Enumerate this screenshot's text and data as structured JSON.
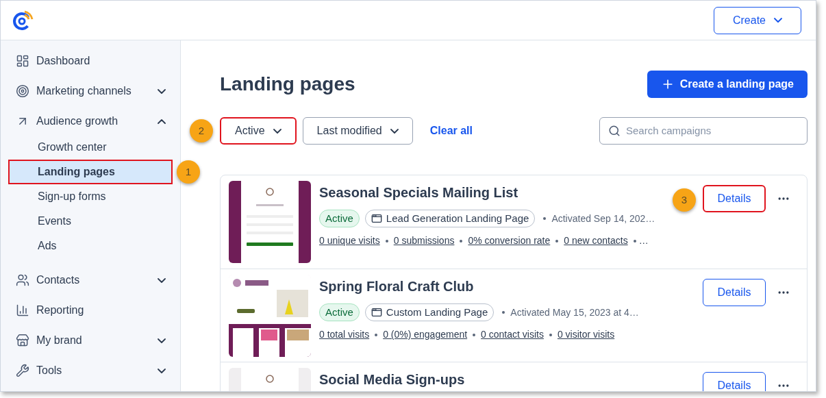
{
  "header": {
    "create_button": "Create"
  },
  "sidebar": {
    "items": [
      {
        "kind": "link",
        "label": "Dashboard"
      },
      {
        "kind": "group",
        "label": "Marketing channels",
        "expanded": false
      },
      {
        "kind": "group",
        "label": "Audience growth",
        "expanded": true,
        "children": [
          {
            "label": "Growth center",
            "selected": false
          },
          {
            "label": "Landing pages",
            "selected": true,
            "highlighted": true,
            "callout": "1"
          },
          {
            "label": "Sign-up forms",
            "selected": false
          },
          {
            "label": "Events",
            "selected": false
          },
          {
            "label": "Ads",
            "selected": false
          }
        ]
      },
      {
        "kind": "group",
        "label": "Contacts",
        "expanded": false
      },
      {
        "kind": "link",
        "label": "Reporting"
      },
      {
        "kind": "group",
        "label": "My brand",
        "expanded": false
      },
      {
        "kind": "group",
        "label": "Tools",
        "expanded": false
      }
    ]
  },
  "page": {
    "title": "Landing pages",
    "create_button": "Create a landing page",
    "filters": [
      {
        "kind": "dropdown",
        "label": "Active",
        "highlighted": true,
        "callout": "2"
      },
      {
        "kind": "dropdown",
        "label": "Last modified",
        "highlighted": false
      },
      {
        "kind": "link",
        "label": "Clear all"
      }
    ],
    "search": {
      "placeholder": "Search campaigns"
    },
    "rows": [
      {
        "title": "Seasonal Specials Mailing List",
        "status": "Active",
        "type": "Lead Generation Landing Page",
        "activated": "Activated Sep 14, 202…",
        "stats": [
          "0 unique visits",
          "0 submissions",
          "0% conversion rate",
          "0 new contacts"
        ],
        "more": "…",
        "details": "Details",
        "highlighted": true,
        "callout": "3",
        "thumbnail": {
          "kind": "picture"
        }
      },
      {
        "title": "Spring Floral Craft Club",
        "status": "Active",
        "type": "Custom Landing Page",
        "activated": "Activated May 15, 2023 at 4…",
        "stats": [
          "0 total visits",
          "0 (0%) engagement",
          "0 contact visits",
          "0 visitor visits"
        ],
        "details": "Details",
        "highlighted": false,
        "thumbnail": {
          "kind": "picture"
        }
      },
      {
        "title": "Social Media Sign-ups",
        "details": "Details",
        "highlighted": false,
        "thumbnail": {
          "kind": "picture"
        }
      }
    ]
  }
}
